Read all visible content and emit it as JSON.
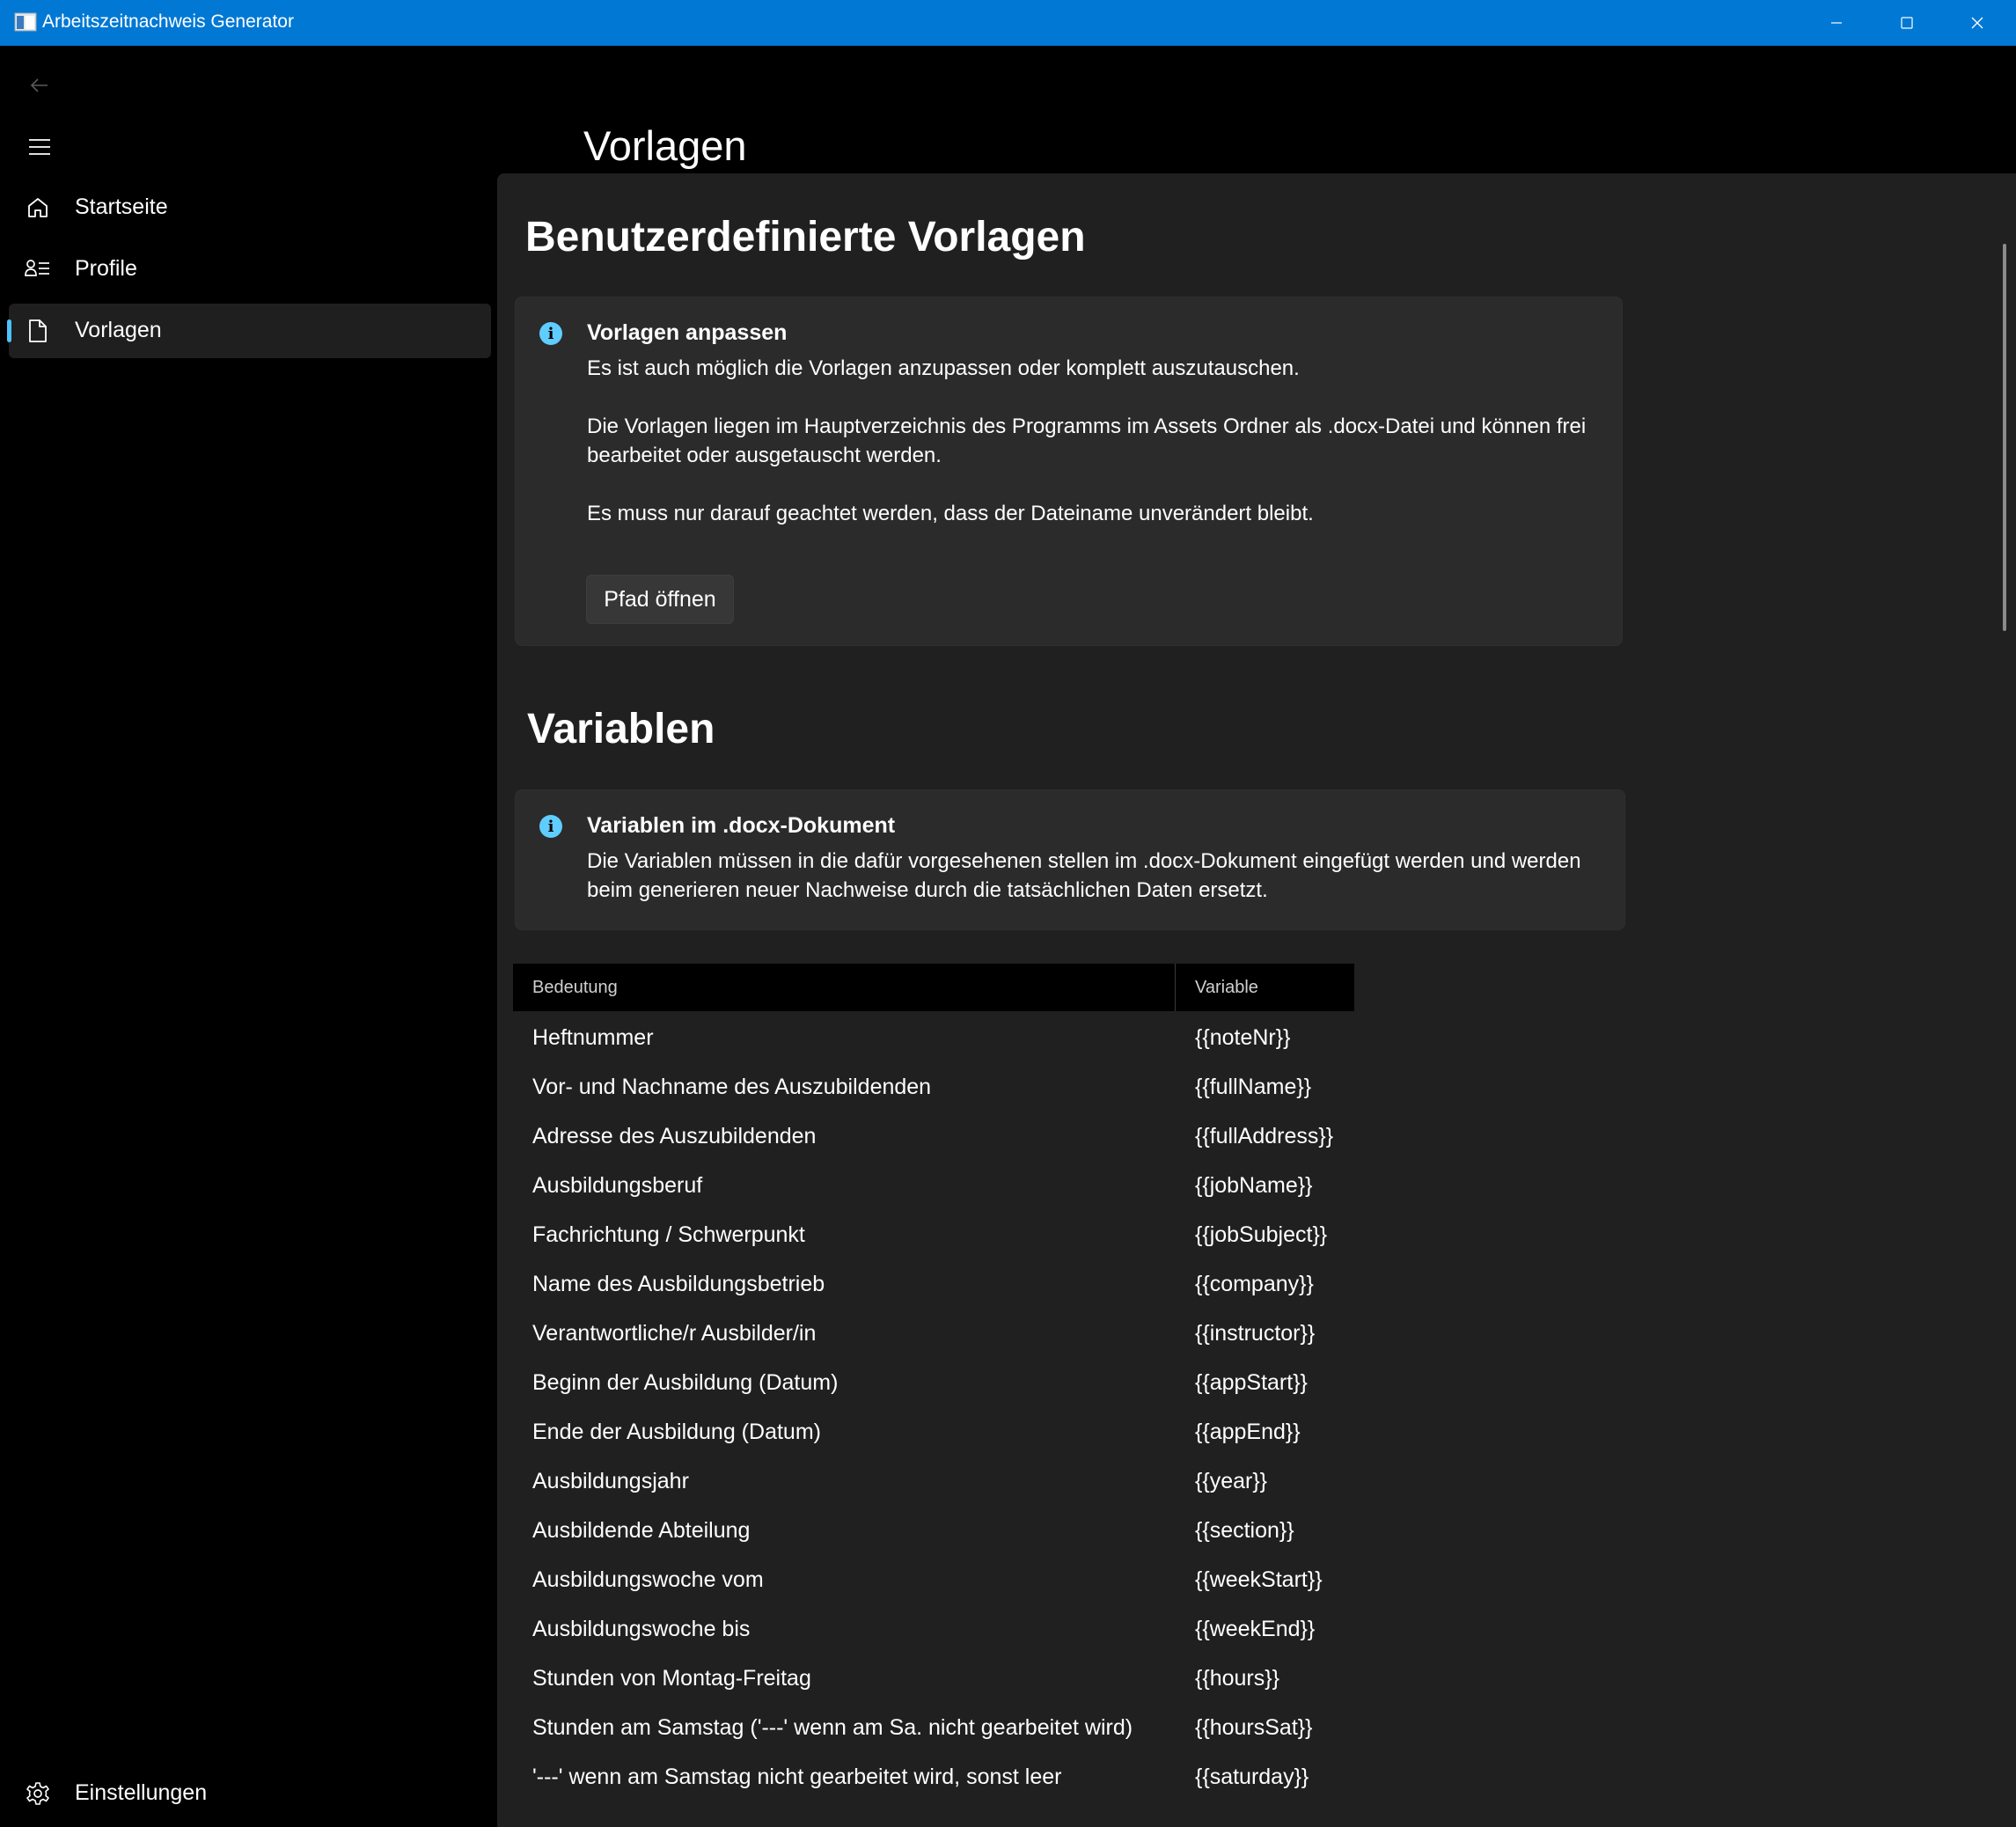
{
  "window": {
    "title": "Arbeitszeitnachweis Generator",
    "accent": "#0078d4"
  },
  "sidebar": {
    "items": [
      {
        "label": "Startseite",
        "icon": "home-icon"
      },
      {
        "label": "Profile",
        "icon": "profiles-icon"
      },
      {
        "label": "Vorlagen",
        "icon": "document-icon",
        "selected": true
      }
    ],
    "settings_label": "Einstellungen"
  },
  "page": {
    "title": "Vorlagen"
  },
  "templates_section": {
    "heading": "Benutzerdefinierte Vorlagen",
    "info_title": "Vorlagen anpassen",
    "line1": "Es ist auch möglich die Vorlagen anzupassen oder komplett auszutauschen.",
    "line2": "Die Vorlagen liegen im Hauptverzeichnis des Programms im Assets Ordner als .docx-Datei und können frei bearbeitet oder ausgetauscht werden.",
    "line3": "Es muss nur darauf geachtet werden, dass der Dateiname unverändert bleibt.",
    "button_label": "Pfad öffnen"
  },
  "variables_section": {
    "heading": "Variablen",
    "info_title": "Variablen im .docx-Dokument",
    "info_text": "Die Variablen müssen in die dafür vorgesehenen stellen im .docx-Dokument eingefügt werden und werden beim generieren neuer Nachweise durch die tatsächlichen Daten ersetzt."
  },
  "table": {
    "headers": [
      "Bedeutung",
      "Variable"
    ],
    "rows": [
      [
        "Heftnummer",
        "{{noteNr}}"
      ],
      [
        "Vor- und Nachname des Auszubildenden",
        "{{fullName}}"
      ],
      [
        "Adresse des Auszubildenden",
        "{{fullAddress}}"
      ],
      [
        "Ausbildungsberuf",
        "{{jobName}}"
      ],
      [
        "Fachrichtung / Schwerpunkt",
        "{{jobSubject}}"
      ],
      [
        "Name des Ausbildungsbetrieb",
        "{{company}}"
      ],
      [
        "Verantwortliche/r Ausbilder/in",
        "{{instructor}}"
      ],
      [
        "Beginn der Ausbildung (Datum)",
        "{{appStart}}"
      ],
      [
        "Ende der Ausbildung (Datum)",
        "{{appEnd}}"
      ],
      [
        "Ausbildungsjahr",
        "{{year}}"
      ],
      [
        "Ausbildende Abteilung",
        "{{section}}"
      ],
      [
        "Ausbildungswoche vom",
        "{{weekStart}}"
      ],
      [
        "Ausbildungswoche bis",
        "{{weekEnd}}"
      ],
      [
        "Stunden von Montag-Freitag",
        "{{hours}}"
      ],
      [
        "Stunden am Samstag ('---' wenn am Sa. nicht gearbeitet wird)",
        "{{hoursSat}}"
      ],
      [
        "'---' wenn am Samstag nicht gearbeitet wird, sonst leer",
        "{{saturday}}"
      ]
    ]
  }
}
